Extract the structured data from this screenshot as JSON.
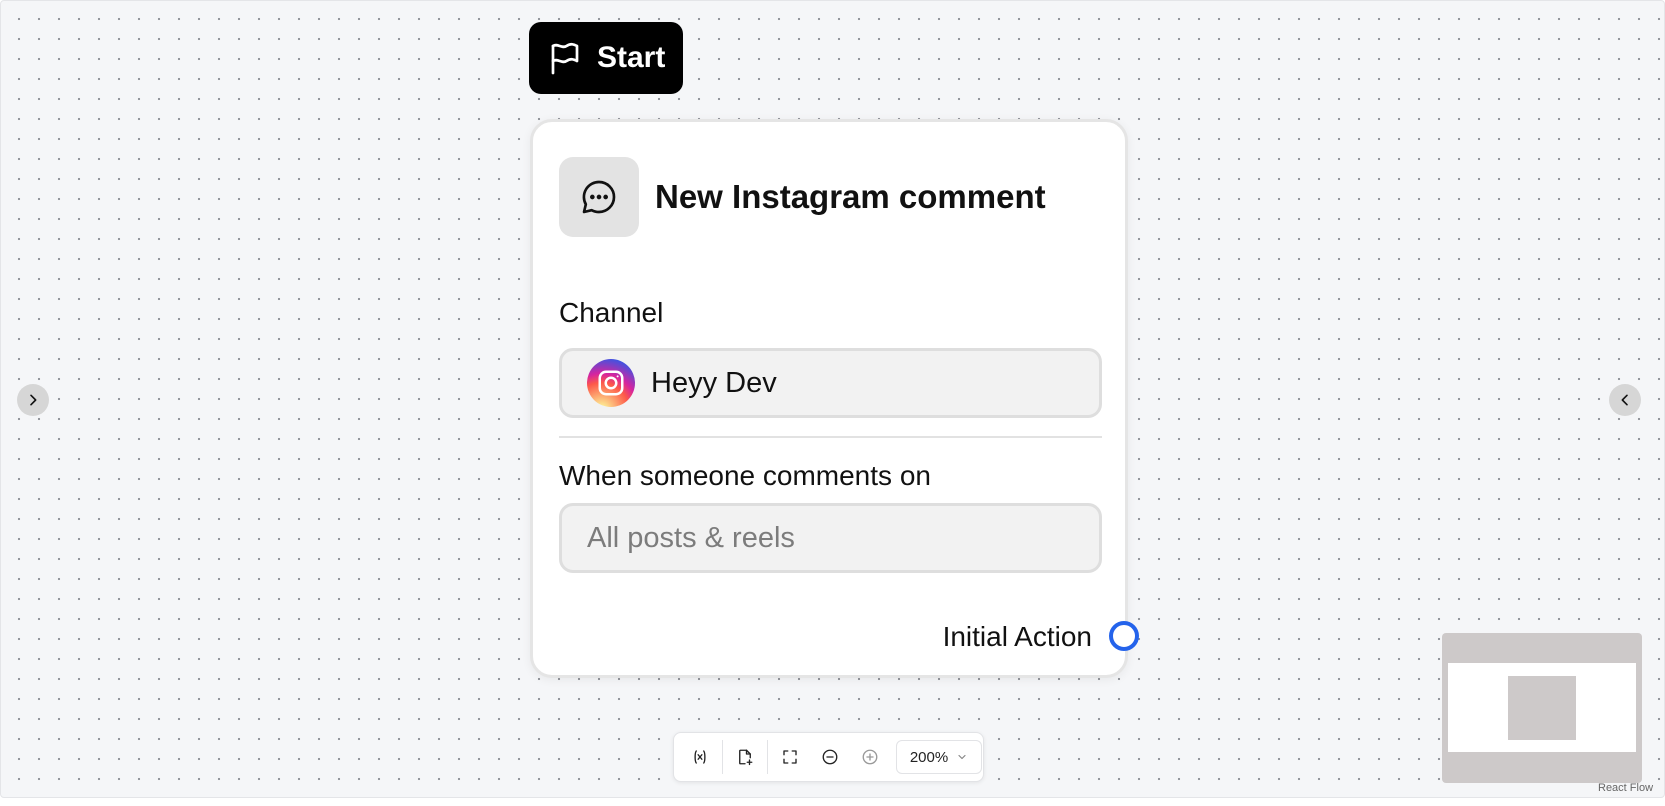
{
  "start": {
    "label": "Start"
  },
  "node": {
    "title": "New Instagram comment",
    "channel_label": "Channel",
    "channel_value": "Heyy Dev",
    "comments_label": "When someone comments on",
    "comments_placeholder": "All posts & reels",
    "output_label": "Initial Action"
  },
  "toolbar": {
    "zoom_value": "200%"
  },
  "attribution": "React Flow",
  "colors": {
    "handle": "#2463eb",
    "start_bg": "#000000"
  }
}
